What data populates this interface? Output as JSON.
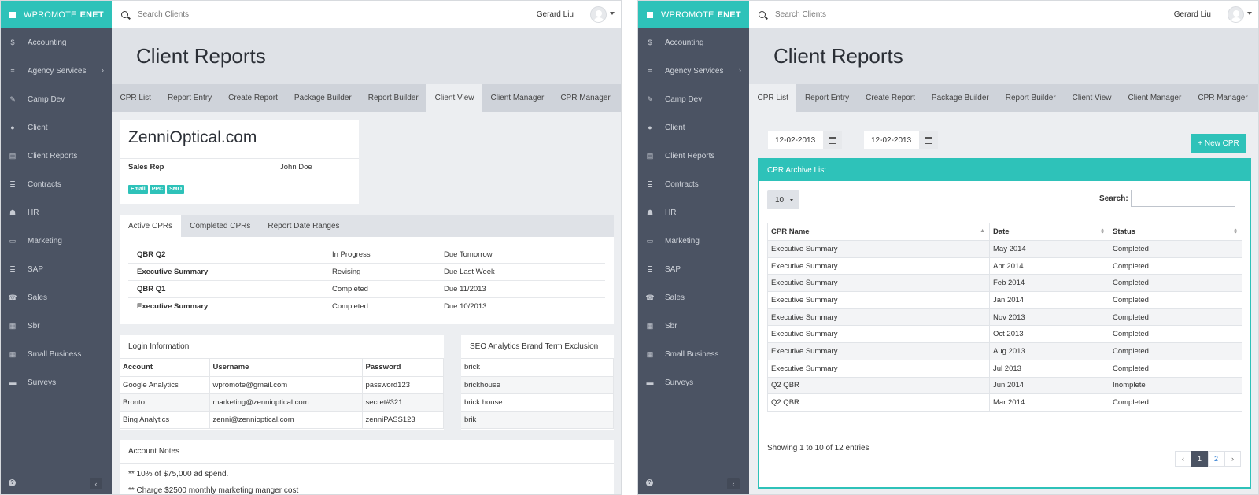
{
  "brand": {
    "name": "WPROMOTE",
    "suffix": "ENET"
  },
  "nav": [
    {
      "label": "Accounting",
      "icon": "dollar-icon"
    },
    {
      "label": "Agency Services",
      "icon": "database-icon",
      "chevron": true
    },
    {
      "label": "Camp Dev",
      "icon": "wrench-icon"
    },
    {
      "label": "Client",
      "icon": "user-icon"
    },
    {
      "label": "Client Reports",
      "icon": "file-icon"
    },
    {
      "label": "Contracts",
      "icon": "list-icon"
    },
    {
      "label": "HR",
      "icon": "users-icon"
    },
    {
      "label": "Marketing",
      "icon": "image-icon"
    },
    {
      "label": "SAP",
      "icon": "list-icon"
    },
    {
      "label": "Sales",
      "icon": "phone-icon"
    },
    {
      "label": "Sbr",
      "icon": "building-icon"
    },
    {
      "label": "Small Business",
      "icon": "building-icon"
    },
    {
      "label": "Surveys",
      "icon": "card-icon"
    }
  ],
  "topbar": {
    "search_placeholder": "Search Clients",
    "user_name": "Gerard Liu"
  },
  "header": {
    "title": "Client Reports"
  },
  "tabs": [
    "CPR List",
    "Report Entry",
    "Create Report",
    "Package Builder",
    "Report Builder",
    "Client View",
    "Client Manager",
    "CPR Manager"
  ],
  "left": {
    "active_tab": "Client View",
    "client": {
      "name": "ZenniOptical.com",
      "sales_rep_label": "Sales Rep",
      "sales_rep": "John Doe",
      "badges": [
        "Email",
        "PPC",
        "SMO"
      ]
    },
    "cpr_tabs": [
      "Active CPRs",
      "Completed CPRs",
      "Report Date Ranges"
    ],
    "cprs": [
      {
        "name": "QBR Q2",
        "status": "In Progress",
        "due": "Due Tomorrow"
      },
      {
        "name": "Executive Summary",
        "status": "Revising",
        "due": "Due Last Week"
      },
      {
        "name": "QBR Q1",
        "status": "Completed",
        "due": "Due 11/2013"
      },
      {
        "name": "Executive Summary",
        "status": "Completed",
        "due": "Due 10/2013"
      }
    ],
    "login": {
      "title": "Login Information",
      "headers": [
        "Account",
        "Username",
        "Password"
      ],
      "rows": [
        [
          "Google Analytics",
          "wpromote@gmail.com",
          "password123"
        ],
        [
          "Bronto",
          "marketing@zennioptical.com",
          "secret#321"
        ],
        [
          "Bing Analytics",
          "zenni@zennioptical.com",
          "zenniPASS123"
        ]
      ]
    },
    "seo": {
      "title": "SEO Analytics Brand Term Exclusion",
      "terms": [
        "brick",
        "brickhouse",
        "brick house",
        "brik"
      ]
    },
    "notes": {
      "title": "Account Notes",
      "lines": [
        "** 10% of $75,000 ad spend.",
        "** Charge $2500 monthly marketing manger cost"
      ]
    }
  },
  "right": {
    "active_tab": "CPR List",
    "date_from": "12-02-2013",
    "date_to": "12-02-2013",
    "new_button": "+ New CPR",
    "archive": {
      "title": "CPR Archive List",
      "page_length": "10",
      "search_label": "Search:",
      "headers": [
        "CPR Name",
        "Date",
        "Status"
      ],
      "rows": [
        [
          "Executive Summary",
          "May 2014",
          "Completed"
        ],
        [
          "Executive Summary",
          "Apr 2014",
          "Completed"
        ],
        [
          "Executive Summary",
          "Feb 2014",
          "Completed"
        ],
        [
          "Executive Summary",
          "Jan 2014",
          "Completed"
        ],
        [
          "Executive Summary",
          "Nov 2013",
          "Completed"
        ],
        [
          "Executive Summary",
          "Oct 2013",
          "Completed"
        ],
        [
          "Executive Summary",
          "Aug 2013",
          "Completed"
        ],
        [
          "Executive Summary",
          "Jul 2013",
          "Completed"
        ],
        [
          "Q2 QBR",
          "Jun 2014",
          "Inomplete"
        ],
        [
          "Q2 QBR",
          "Mar 2014",
          "Completed"
        ]
      ],
      "info": "Showing 1 to 10 of 12 entries",
      "pages": [
        "1",
        "2"
      ],
      "current_page": "1"
    }
  },
  "colors": {
    "accent": "#2ec2b9",
    "sidebar": "#4b5363",
    "header_bg": "#dfe2e7",
    "tab_bar": "#cfd3da"
  }
}
